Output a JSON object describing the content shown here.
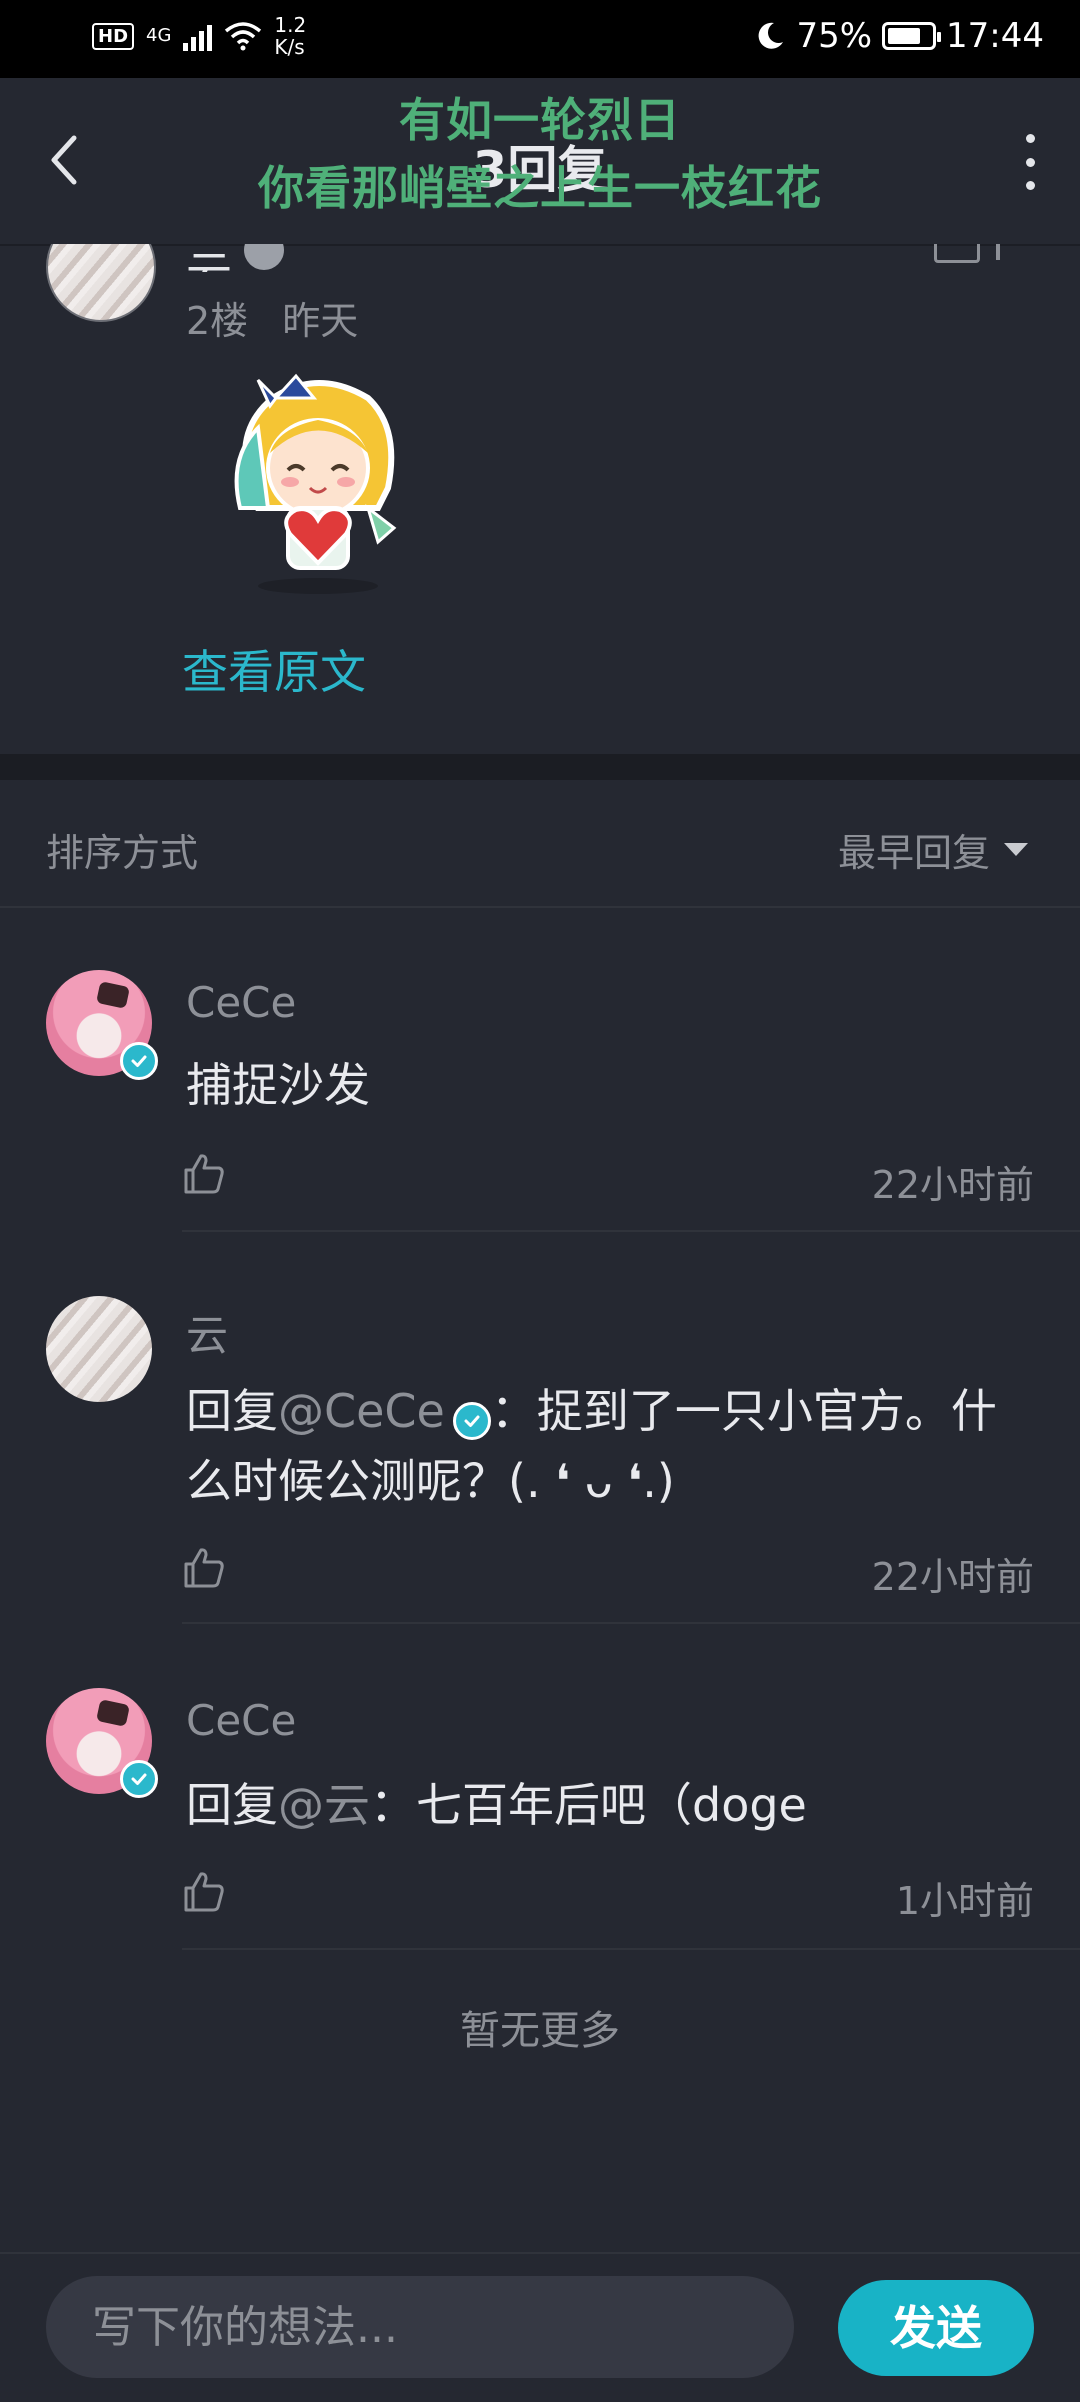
{
  "status_bar": {
    "hd": "HD",
    "network": "4G",
    "speed_value": "1.2",
    "speed_unit": "K/s",
    "battery": "75%",
    "time": "17:44",
    "battery_level_percent": 75
  },
  "header": {
    "title": "3回复",
    "overlay_line1": "有如一轮烈日",
    "overlay_line2": "你看那峭壁之上生一枝红花"
  },
  "floor": {
    "author": "云",
    "floor": "2楼",
    "time": "昨天",
    "view_original": "查看原文"
  },
  "sort": {
    "label": "排序方式",
    "value": "最早回复"
  },
  "replies": [
    {
      "name": "CeCe",
      "text": "捕捉沙发",
      "time": "22小时前"
    },
    {
      "name": "云",
      "prefix": "回复",
      "mention": "@CeCe",
      "text": "：捉到了一只小官方。什么时候公测呢？(. ❛ ᴗ ❛.)",
      "time": "22小时前"
    },
    {
      "name": "CeCe",
      "prefix": "回复",
      "mention": "@云",
      "text": "：七百年后吧（doge",
      "time": "1小时前"
    }
  ],
  "footer_note": "暂无更多",
  "composer": {
    "placeholder": "写下你的想法...",
    "send_label": "发送"
  },
  "colors": {
    "accent": "#18b3c6",
    "overlay_text": "#4fb079",
    "background": "#252831"
  }
}
